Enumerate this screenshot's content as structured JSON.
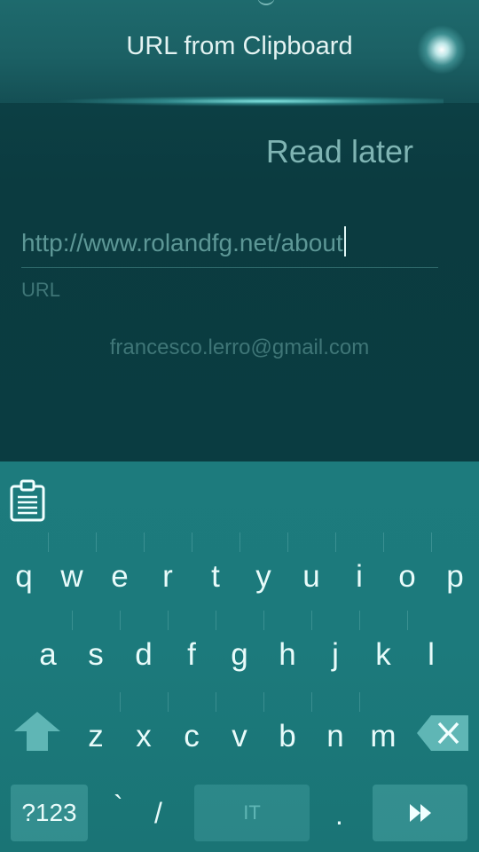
{
  "header": {
    "title": "URL from Clipboard"
  },
  "form": {
    "action_label": "Read later",
    "url_value": "http://www.rolandfg.net/about",
    "url_label": "URL",
    "account_email": "francesco.lerro@gmail.com"
  },
  "keyboard": {
    "clipboard_icon": "clipboard-icon",
    "row1": [
      "q",
      "w",
      "e",
      "r",
      "t",
      "y",
      "u",
      "i",
      "o",
      "p"
    ],
    "row2": [
      "a",
      "s",
      "d",
      "f",
      "g",
      "h",
      "j",
      "k",
      "l"
    ],
    "row3": [
      "z",
      "x",
      "c",
      "v",
      "b",
      "n",
      "m"
    ],
    "symbols_label": "?123",
    "backtick": "`",
    "slash": "/",
    "language_label": "IT",
    "period": ".",
    "shift_icon": "shift-icon",
    "backspace_icon": "backspace-icon",
    "enter_icon": "enter-icon"
  },
  "colors": {
    "background": "#0a3a3e",
    "keyboard": "#1c7a7c",
    "text_primary": "#e4f3f2",
    "text_muted": "#3f7677"
  }
}
